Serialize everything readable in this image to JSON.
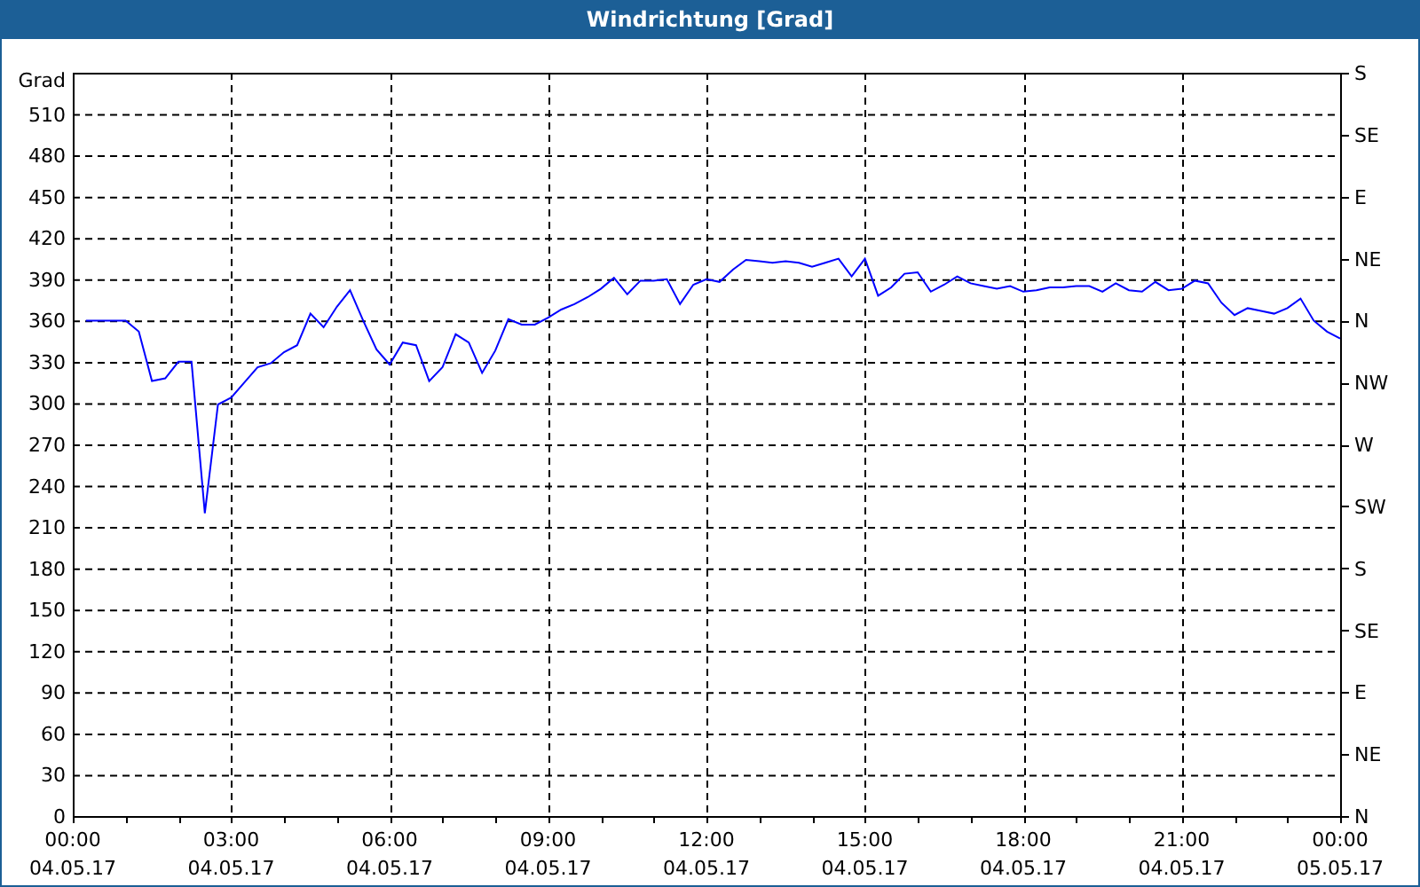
{
  "window": {
    "title": "Windrichtung [Grad]"
  },
  "chart": {
    "chart_data": {
      "type": "line",
      "ylabel": "Grad",
      "ylim": [
        0,
        540
      ],
      "grid": true,
      "yticks": [
        0,
        30,
        60,
        90,
        120,
        150,
        180,
        210,
        240,
        270,
        300,
        330,
        360,
        390,
        420,
        450,
        480,
        510
      ],
      "categories": [
        "00:00 04.05.17",
        null,
        null,
        null,
        null,
        null,
        null,
        null,
        null,
        null,
        null,
        null,
        "03:00 04.05.17",
        null,
        null,
        null,
        null,
        null,
        null,
        null,
        null,
        null,
        null,
        null,
        "06:00 04.05.17",
        null,
        null,
        null,
        null,
        null,
        null,
        null,
        null,
        null,
        null,
        null,
        "09:00 04.05.17",
        null,
        null,
        null,
        null,
        null,
        null,
        null,
        null,
        null,
        null,
        null,
        "12:00 04.05.17",
        null,
        null,
        null,
        null,
        null,
        null,
        null,
        null,
        null,
        null,
        null,
        "15:00 04.05.17",
        null,
        null,
        null,
        null,
        null,
        null,
        null,
        null,
        null,
        null,
        null,
        "18:00 04.05.17",
        null,
        null,
        null,
        null,
        null,
        null,
        null,
        null,
        null,
        null,
        null,
        "21:00 04.05.17",
        null,
        null,
        null,
        null,
        null,
        null,
        null,
        null,
        null,
        null,
        null,
        "00:00 05.05.17"
      ],
      "series": [
        {
          "color": "#0000ff",
          "values": [
            null,
            360,
            360,
            360,
            360,
            352,
            316,
            318,
            330,
            330,
            220,
            299,
            304,
            315,
            326,
            329,
            337,
            342,
            365,
            355,
            370,
            382,
            360,
            339,
            328,
            344,
            342,
            316,
            326,
            350,
            344,
            322,
            338,
            361,
            357,
            357,
            362,
            368,
            372,
            377,
            383,
            391,
            379,
            389,
            389,
            390,
            372,
            386,
            390,
            388,
            397,
            404,
            403,
            402,
            403,
            402,
            399,
            402,
            405,
            392,
            405,
            378,
            384,
            394,
            395,
            381,
            386,
            392,
            387,
            385,
            383,
            385,
            381,
            382,
            384,
            384,
            385,
            385,
            381,
            387,
            382,
            381,
            388,
            382,
            383,
            389,
            387,
            373,
            364,
            369,
            367,
            365,
            369,
            376,
            360,
            352,
            347
          ]
        }
      ]
    },
    "right_ticks": [
      "S",
      "SE",
      "E",
      "NE",
      "N",
      "NW",
      "W",
      "SW",
      "S",
      "SE",
      "E",
      "NE",
      "N"
    ]
  }
}
